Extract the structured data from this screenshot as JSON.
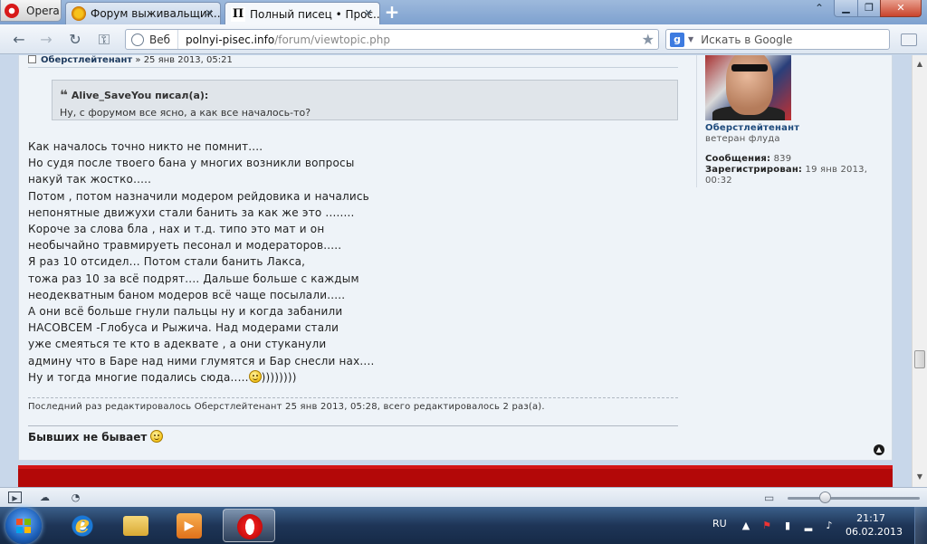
{
  "browser": {
    "menu_label": "Opera",
    "tabs": [
      {
        "title": "Форум выживальщик..."
      },
      {
        "title": "Полный писец • Прос..."
      }
    ],
    "address": {
      "web_chip": "Веб",
      "host": "polnyi-pisec.info",
      "path": "/forum/viewtopic.php"
    },
    "search": {
      "placeholder": "Искать в Google"
    }
  },
  "post": {
    "author": "Оберстлейтенант",
    "date_sep": " » ",
    "date": "25 янв 2013, 05:21",
    "quote": {
      "author_line": "Alive_SaveYou писал(а):",
      "text": "Ну, с форумом все ясно, а как все началось-то?"
    },
    "body_lines": [
      "Как началось точно никто не помнит....",
      "Но судя после твоего бана у многих возникли вопросы",
      "накуй так жостко.....",
      "Потом , потом назначили модером рейдовика и начались",
      "непонятные движухи стали банить за как же это ........",
      "Короче за слова бла , нах и т.д. типо это мат и он",
      "необычайно травмируеть песонал и модераторов.....",
      "Я раз 10 отсидел... Потом стали банить Лакса,",
      "тожа раз 10 за всё подрят.... Дальше больше с каждым",
      "неодекватным баном модеров всё чаще посылали.....",
      "А они всё больше гнули пальцы ну и когда забанили",
      "НАСОВСЕМ -Глобуса и Рыжича. Над модерами стали",
      "уже смеяться те кто в адеквате , а они стуканули",
      "админу что в Баре над ними глумятся и Бар снесли нах....",
      "Ну и тогда многие подались сюда....."
    ],
    "body_tail": "))))))))",
    "edit_note": "Последний раз редактировалось Оберстлейтенант 25 янв 2013, 05:28, всего редактировалось 2 раз(а).",
    "signature": "Бывших не бывает"
  },
  "profile": {
    "name": "Оберстлейтенант",
    "rank": "ветеран флуда",
    "posts_label": "Сообщения:",
    "posts_value": "839",
    "registered_label": "Зарегистрирован:",
    "registered_value": "19 янв 2013, 00:32"
  },
  "taskbar": {
    "lang": "RU",
    "time": "21:17",
    "date": "06.02.2013"
  },
  "colors": {
    "accent_red": "#c40b0b",
    "link_blue": "#1d4a7c",
    "page_bg": "#eef3f8"
  }
}
